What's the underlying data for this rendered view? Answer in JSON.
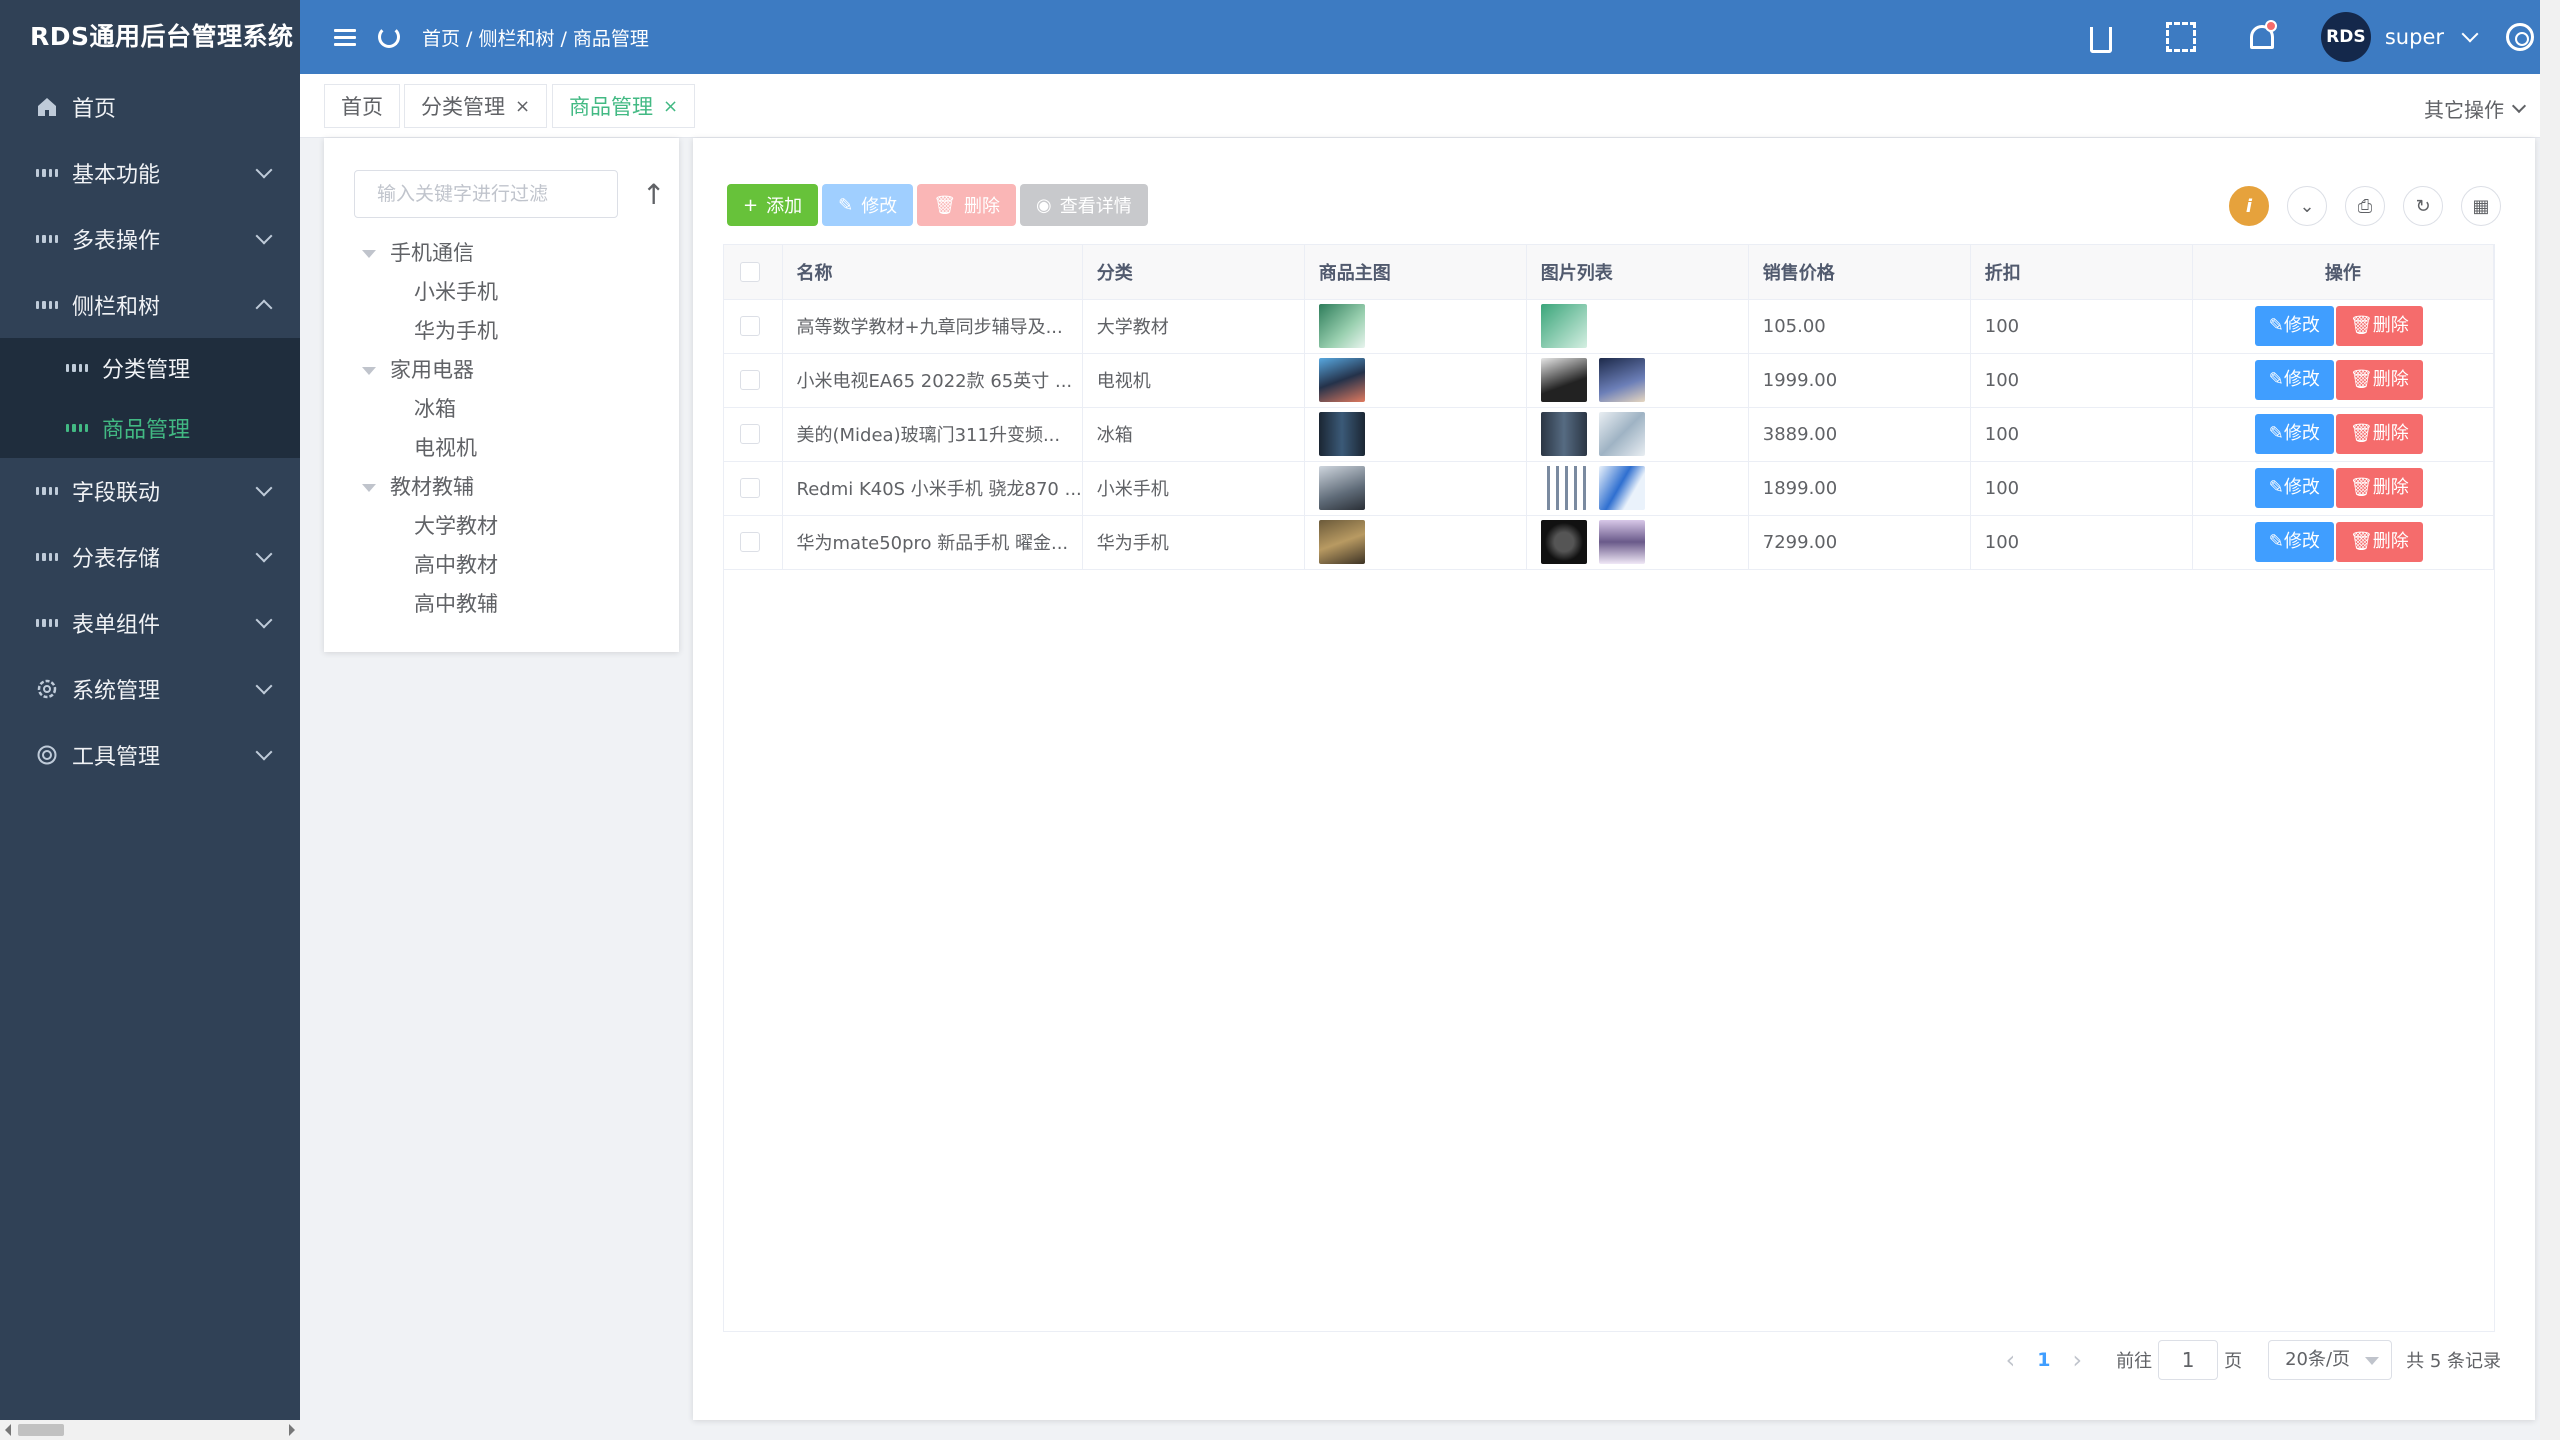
{
  "app": {
    "title": "RDS通用后台管理系统"
  },
  "sidebar": {
    "items": [
      {
        "label": "首页",
        "icon": "home-icon"
      },
      {
        "label": "基本功能",
        "icon": "grid-icon"
      },
      {
        "label": "多表操作",
        "icon": "grid-icon"
      },
      {
        "label": "侧栏和树",
        "icon": "grid-icon"
      },
      {
        "label": "字段联动",
        "icon": "grid-icon"
      },
      {
        "label": "分表存储",
        "icon": "grid-icon"
      },
      {
        "label": "表单组件",
        "icon": "grid-icon"
      },
      {
        "label": "系统管理",
        "icon": "gear-icon"
      },
      {
        "label": "工具管理",
        "icon": "tool-icon"
      }
    ],
    "subitems": [
      {
        "label": "分类管理"
      },
      {
        "label": "商品管理"
      }
    ]
  },
  "header": {
    "breadcrumb": [
      "首页",
      "/ 侧栏和树",
      "/ 商品管理"
    ],
    "avatar_text": "RDS",
    "username": "super"
  },
  "tabs": {
    "items": [
      {
        "label": "首页"
      },
      {
        "label": "分类管理"
      },
      {
        "label": "商品管理"
      }
    ],
    "close": "×",
    "other_ops": "其它操作"
  },
  "tree": {
    "search_placeholder": "输入关键字进行过滤",
    "groups": [
      {
        "label": "手机通信",
        "children": [
          "小米手机",
          "华为手机"
        ]
      },
      {
        "label": "家用电器",
        "children": [
          "冰箱",
          "电视机"
        ]
      },
      {
        "label": "教材教辅",
        "children": [
          "大学教材",
          "高中教材",
          "高中教辅"
        ]
      }
    ]
  },
  "toolbar": {
    "add": "添加",
    "edit": "修改",
    "delete": "删除",
    "view": "查看详情"
  },
  "table": {
    "columns": [
      "名称",
      "分类",
      "商品主图",
      "图片列表",
      "销售价格",
      "折扣",
      "操作"
    ],
    "rows": [
      {
        "name": "高等数学教材+九章同步辅导及...",
        "category": "大学教材",
        "price": "105.00",
        "discount": "100"
      },
      {
        "name": "小米电视EA65 2022款 65英寸 ...",
        "category": "电视机",
        "price": "1999.00",
        "discount": "100"
      },
      {
        "name": "美的(Midea)玻璃门311升变频...",
        "category": "冰箱",
        "price": "3889.00",
        "discount": "100"
      },
      {
        "name": "Redmi K40S 小米手机 骁龙870 ...",
        "category": "小米手机",
        "price": "1899.00",
        "discount": "100"
      },
      {
        "name": "华为mate50pro 新品手机 曜金...",
        "category": "华为手机",
        "price": "7299.00",
        "discount": "100"
      }
    ],
    "op_edit": "修改",
    "op_delete": "删除"
  },
  "pager": {
    "current": "1",
    "goto_label": "前往",
    "goto_value": "1",
    "page_unit": "页",
    "page_size": "20条/页",
    "total": "共 5 条记录"
  }
}
